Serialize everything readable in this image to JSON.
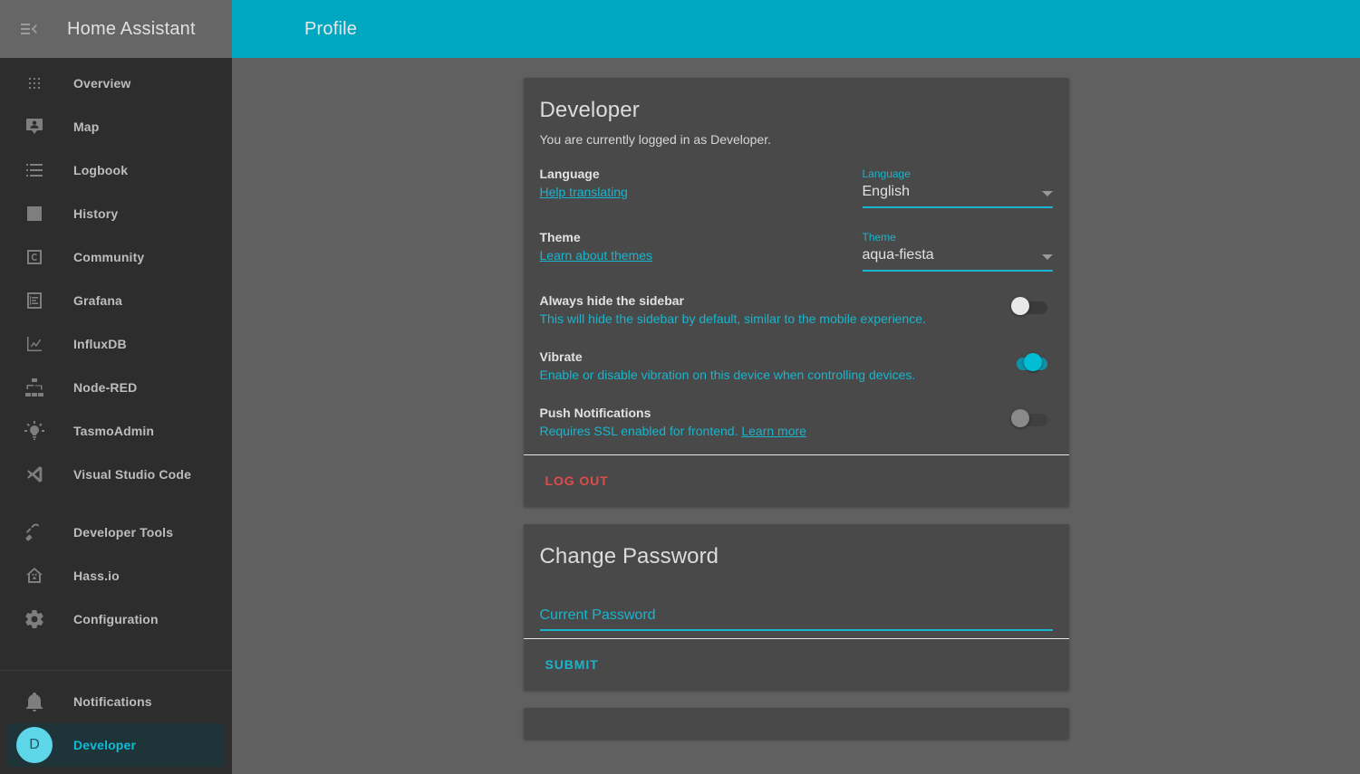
{
  "sidebar": {
    "title": "Home Assistant",
    "menu_icon": "menu-open-icon",
    "items": [
      {
        "label": "Overview",
        "icon": "view-dashboard-icon"
      },
      {
        "label": "Map",
        "icon": "map-marker-account-icon"
      },
      {
        "label": "Logbook",
        "icon": "format-list-bulleted-icon"
      },
      {
        "label": "History",
        "icon": "chart-box-icon"
      },
      {
        "label": "Community",
        "icon": "letter-c-icon"
      },
      {
        "label": "Grafana",
        "icon": "chart-document-icon"
      },
      {
        "label": "InfluxDB",
        "icon": "chart-line-icon"
      },
      {
        "label": "Node-RED",
        "icon": "sitemap-icon"
      },
      {
        "label": "TasmoAdmin",
        "icon": "lightbulb-on-icon"
      },
      {
        "label": "Visual Studio Code",
        "icon": "vscode-icon"
      }
    ],
    "config_items": [
      {
        "label": "Developer Tools",
        "icon": "hammer-icon"
      },
      {
        "label": "Hass.io",
        "icon": "home-assistant-io-icon"
      },
      {
        "label": "Configuration",
        "icon": "cog-icon"
      }
    ],
    "bottom_items": [
      {
        "label": "Notifications",
        "icon": "bell-icon"
      }
    ],
    "profile": {
      "label": "Developer",
      "avatar_initial": "D",
      "selected": true
    }
  },
  "header": {
    "title": "Profile"
  },
  "profile_card": {
    "title": "Developer",
    "subtitle": "You are currently logged in as Developer.",
    "language": {
      "name": "Language",
      "link": "Help translating",
      "field_label": "Language",
      "value": "English"
    },
    "theme": {
      "name": "Theme",
      "link": "Learn about themes",
      "field_label": "Theme",
      "value": "aqua-fiesta"
    },
    "hide_sidebar": {
      "name": "Always hide the sidebar",
      "desc": "This will hide the sidebar by default, similar to the mobile experience.",
      "state": "off"
    },
    "vibrate": {
      "name": "Vibrate",
      "desc": "Enable or disable vibration on this device when controlling devices.",
      "state": "on"
    },
    "push_notifications": {
      "name": "Push Notifications",
      "desc": "Requires SSL enabled for frontend.",
      "link": "Learn more",
      "state": "disabled"
    },
    "logout_label": "LOG OUT"
  },
  "password_card": {
    "title": "Change Password",
    "current_password_placeholder": "Current Password",
    "current_password_value": "",
    "submit_label": "SUBMIT"
  },
  "colors": {
    "accent": "#17B6CE",
    "header": "#00A7C0",
    "card_bg": "#494949",
    "page_bg": "#606060",
    "sidebar_bg": "#2D2D2D",
    "danger": "#E04B4B",
    "avatar": "#5CD6E8"
  }
}
